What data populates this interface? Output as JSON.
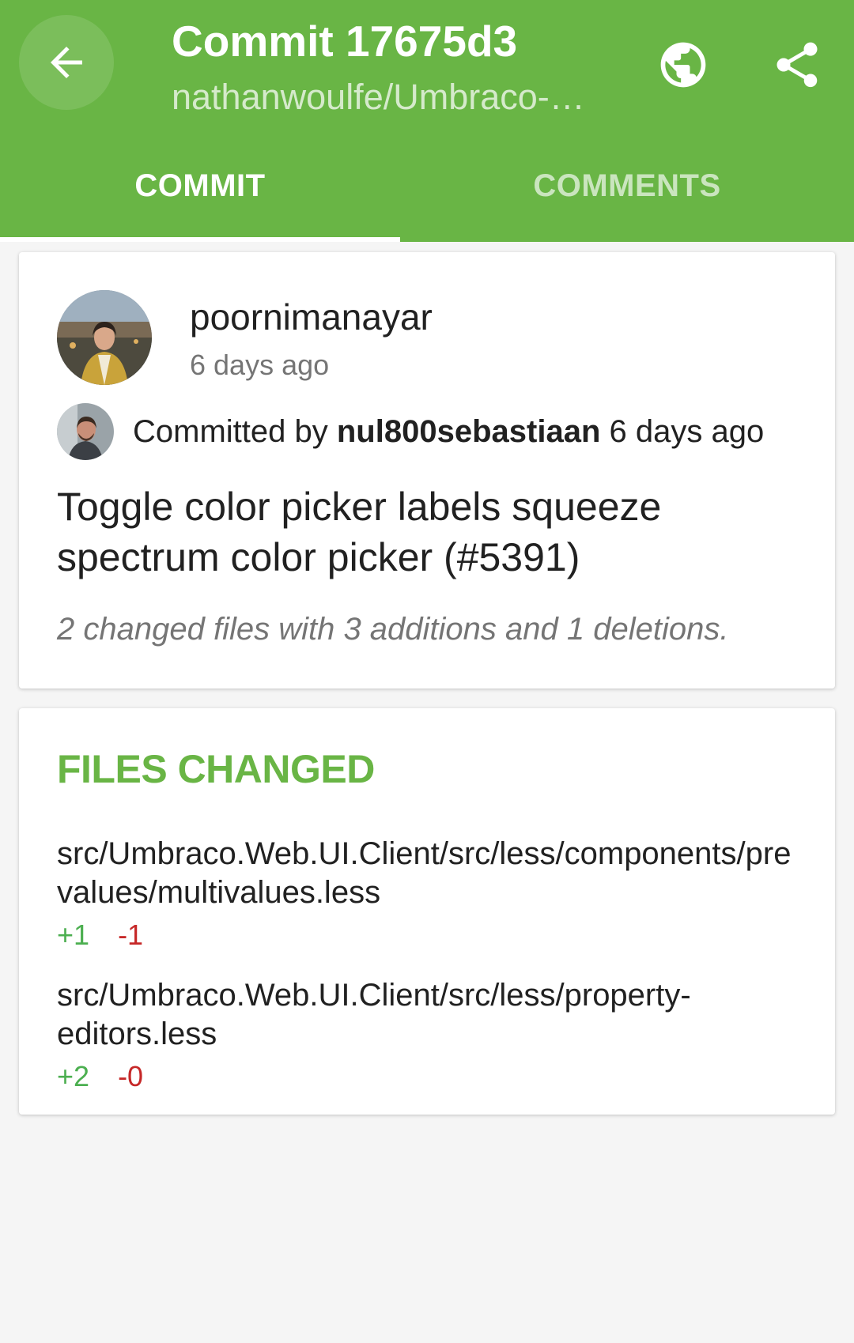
{
  "header": {
    "title": "Commit 17675d3",
    "subtitle": "nathanwoulfe/Umbraco-…",
    "back_icon": "arrow-back-icon",
    "globe_icon": "globe-icon",
    "share_icon": "share-icon",
    "background_color": "#69b545"
  },
  "tabs": [
    {
      "label": "COMMIT",
      "selected": true
    },
    {
      "label": "COMMENTS",
      "selected": false
    }
  ],
  "commit": {
    "author": "poornimanayar",
    "author_time": "6 days ago",
    "committed_by_prefix": "Committed by",
    "committer": "nul800sebastiaan",
    "committed_time": "6 days ago",
    "message": "Toggle color picker labels squeeze spectrum color picker (#5391)",
    "stats": "2 changed files with 3 additions and 1 deletions."
  },
  "files_changed": {
    "heading": "FILES CHANGED",
    "files": [
      {
        "path": "src/Umbraco.Web.UI.Client/src/less/components/prevalues/multivalues.less",
        "additions": "+1",
        "deletions": "-1"
      },
      {
        "path": "src/Umbraco.Web.UI.Client/src/less/property-editors.less",
        "additions": "+2",
        "deletions": "-0"
      }
    ]
  },
  "colors": {
    "accent": "#69b545",
    "addition": "#4caf50",
    "deletion": "#c62828"
  }
}
